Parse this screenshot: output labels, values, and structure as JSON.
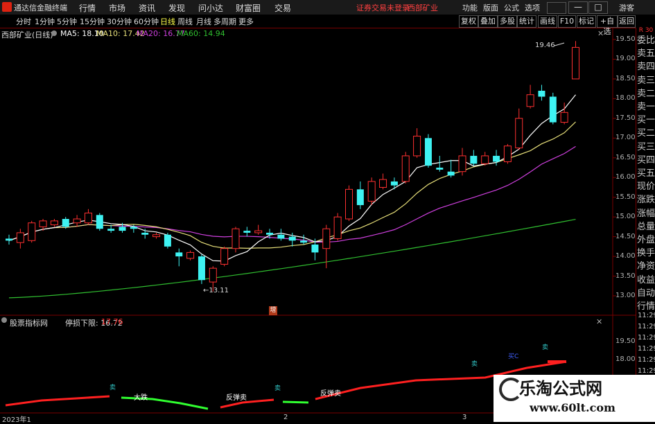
{
  "app": {
    "title": "通达信金融终端",
    "menus": [
      "行情",
      "市场",
      "资讯",
      "发现",
      "问小达",
      "财富圈",
      "交易"
    ],
    "notice": "证券交易未登录",
    "stock_name_top": "西部矿业",
    "right_menus": [
      "功能",
      "版面",
      "公式",
      "选项"
    ],
    "guest": "游客",
    "win_buttons": [
      "—",
      "□",
      "✕"
    ]
  },
  "toolbar": {
    "periods": [
      "分时",
      "1分钟",
      "5分钟",
      "15分钟",
      "30分钟",
      "60分钟",
      "日线",
      "周线",
      "月线",
      "多周期",
      "更多"
    ],
    "active_index": 6,
    "right_buttons": [
      "复权",
      "叠加",
      "多股",
      "统计",
      "画线",
      "F10",
      "标记",
      "+自选",
      "返回"
    ]
  },
  "chart": {
    "title": "西部矿业(日线)",
    "ma": [
      {
        "label": "MA5: 18.10",
        "color": "#ffffff"
      },
      {
        "label": "MA10: 17.42",
        "color": "#e8e07a"
      },
      {
        "label": "MA20: 16.77",
        "color": "#d040e0"
      },
      {
        "label": "MA60: 14.94",
        "color": "#30c030"
      }
    ],
    "y_ticks": [
      "19.50",
      "19.00",
      "18.50",
      "18.00",
      "17.50",
      "17.00",
      "16.50",
      "16.00",
      "15.50",
      "15.00",
      "14.50",
      "14.00",
      "13.50",
      "13.00"
    ],
    "high_label": "19.46",
    "low_label": "13.11",
    "event_marker": "增",
    "indicator_title": "股票指标网",
    "indicator_line": "停损下限: 16.72",
    "indicator_value": "17.76",
    "indicator_y_ticks": [
      "19.50",
      "18.00"
    ],
    "signal_labels": [
      "大跌",
      "反弹卖",
      "反弹卖",
      "卖",
      "卖",
      "卖",
      "卖",
      "卖"
    ],
    "blue_label": "买C",
    "x_labels": [
      "2023年1",
      "2",
      "3"
    ]
  },
  "right_panel": {
    "items": [
      "委比",
      "卖五",
      "卖四",
      "卖三",
      "卖二",
      "卖一",
      "买一",
      "买二",
      "买三",
      "买四",
      "买五",
      "现价",
      "涨跌",
      "涨幅",
      "总量",
      "外盘",
      "换手",
      "净资",
      "收益",
      "自动",
      "行情"
    ],
    "top_tag": "R 30",
    "times": [
      "11:29",
      "11:29",
      "11:29",
      "11:29",
      "11:29",
      "11:29",
      "11:29",
      "11:29",
      "11:29",
      "11:29"
    ]
  },
  "watermark": {
    "title": "乐淘公式网",
    "url": "www.60lt.com"
  },
  "chart_data": {
    "type": "candlestick",
    "title": "西部矿业(日线)",
    "ylim": [
      12.8,
      19.7
    ],
    "candles": [
      [
        14.45,
        14.4,
        14.55,
        14.3
      ],
      [
        14.35,
        14.6,
        14.7,
        14.2
      ],
      [
        14.4,
        14.85,
        14.9,
        14.35
      ],
      [
        14.75,
        14.9,
        14.95,
        14.65
      ],
      [
        14.8,
        14.9,
        14.95,
        14.75
      ],
      [
        14.95,
        14.75,
        15.0,
        14.7
      ],
      [
        14.85,
        14.95,
        15.05,
        14.75
      ],
      [
        14.85,
        15.1,
        15.2,
        14.8
      ],
      [
        15.05,
        14.7,
        15.1,
        14.65
      ],
      [
        14.7,
        14.65,
        14.8,
        14.6
      ],
      [
        14.75,
        14.65,
        14.85,
        14.6
      ],
      [
        14.75,
        14.7,
        14.8,
        14.6
      ],
      [
        14.6,
        14.55,
        14.7,
        14.45
      ],
      [
        14.5,
        14.55,
        14.6,
        14.45
      ],
      [
        14.55,
        14.25,
        14.6,
        14.2
      ],
      [
        14.1,
        14.0,
        14.2,
        13.75
      ],
      [
        13.95,
        14.1,
        14.15,
        13.9
      ],
      [
        14.0,
        13.4,
        14.05,
        13.3
      ],
      [
        13.35,
        13.7,
        13.75,
        13.11
      ],
      [
        13.8,
        14.2,
        14.25,
        13.75
      ],
      [
        14.2,
        14.7,
        14.75,
        14.1
      ],
      [
        14.65,
        14.6,
        14.75,
        14.5
      ],
      [
        14.6,
        14.65,
        14.8,
        14.55
      ],
      [
        14.6,
        14.55,
        14.7,
        14.45
      ],
      [
        14.55,
        14.45,
        14.7,
        14.4
      ],
      [
        14.5,
        14.4,
        14.6,
        14.25
      ],
      [
        14.4,
        14.35,
        14.55,
        14.3
      ],
      [
        14.3,
        14.1,
        14.45,
        13.9
      ],
      [
        14.2,
        14.7,
        14.8,
        13.7
      ],
      [
        14.45,
        15.0,
        15.1,
        14.4
      ],
      [
        14.95,
        15.7,
        15.8,
        14.9
      ],
      [
        15.7,
        15.3,
        15.9,
        15.2
      ],
      [
        15.4,
        15.9,
        16.0,
        15.3
      ],
      [
        15.75,
        15.95,
        16.1,
        15.7
      ],
      [
        15.9,
        15.8,
        16.0,
        15.7
      ],
      [
        15.9,
        16.55,
        16.65,
        15.85
      ],
      [
        16.55,
        17.05,
        17.25,
        16.5
      ],
      [
        17.0,
        16.3,
        17.1,
        16.25
      ],
      [
        16.25,
        16.2,
        16.55,
        16.15
      ],
      [
        16.15,
        16.05,
        16.45,
        16.0
      ],
      [
        16.15,
        16.55,
        16.75,
        16.05
      ],
      [
        16.55,
        16.35,
        16.7,
        16.3
      ],
      [
        16.35,
        16.55,
        16.65,
        16.3
      ],
      [
        16.55,
        16.4,
        16.7,
        16.3
      ],
      [
        16.4,
        16.8,
        16.85,
        16.35
      ],
      [
        16.75,
        17.5,
        17.75,
        16.7
      ],
      [
        17.8,
        18.1,
        18.35,
        17.75
      ],
      [
        18.2,
        18.05,
        18.35,
        17.95
      ],
      [
        18.05,
        17.4,
        18.15,
        17.35
      ],
      [
        17.4,
        17.65,
        17.9,
        17.35
      ],
      [
        18.5,
        19.3,
        19.46,
        18.5
      ]
    ]
  }
}
